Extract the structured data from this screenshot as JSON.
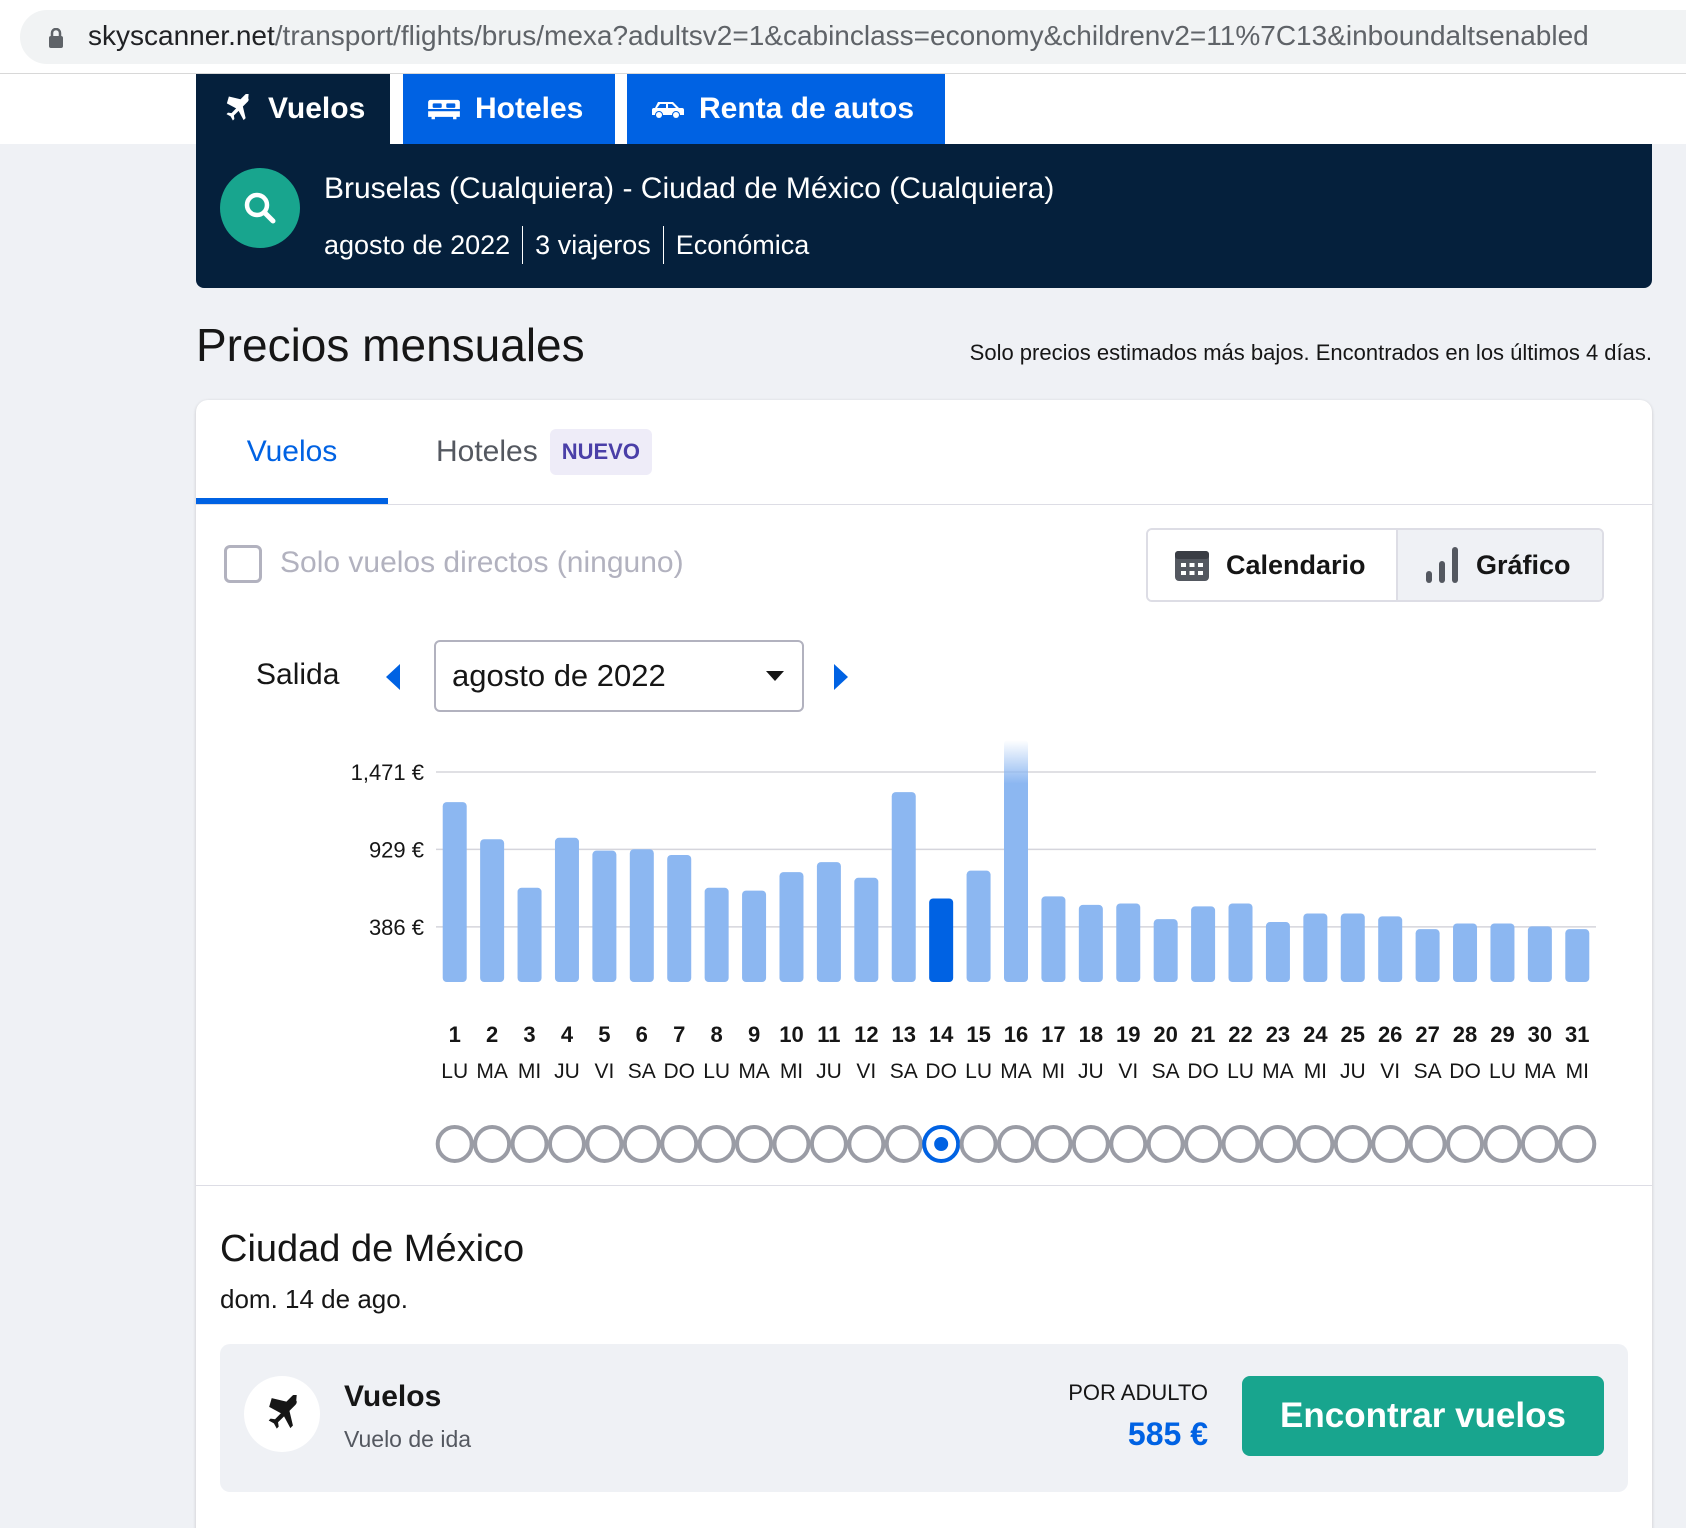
{
  "browser": {
    "url_host": "skyscanner.net",
    "url_path": "/transport/flights/brus/mexa?adultsv2=1&cabinclass=economy&childrenv2=11%7C13&inboundaltsenabled"
  },
  "product_tabs": [
    {
      "label": "Vuelos",
      "icon": "plane-icon",
      "active": true
    },
    {
      "label": "Hoteles",
      "icon": "bed-icon",
      "active": false
    },
    {
      "label": "Renta de autos",
      "icon": "car-icon",
      "active": false
    }
  ],
  "search_summary": {
    "route": "Bruselas (Cualquiera) - Ciudad de México (Cualquiera)",
    "month": "agosto de 2022",
    "travellers": "3 viajeros",
    "cabin": "Económica"
  },
  "heading": {
    "title": "Precios mensuales",
    "note": "Solo precios estimados más bajos. Encontrados en los últimos 4 días."
  },
  "card_tabs": {
    "flights": "Vuelos",
    "hotels": "Hoteles",
    "hotels_badge": "NUEVO"
  },
  "filters": {
    "direct_only_label": "Solo vuelos directos (ninguno)",
    "direct_only_checked": false
  },
  "view_toggle": {
    "calendar": "Calendario",
    "chart": "Gráfico",
    "selected": "Gráfico"
  },
  "departure": {
    "label": "Salida",
    "month_value": "agosto de 2022"
  },
  "colors": {
    "bar": "#8cb7f1",
    "bar_selected": "#0062e3",
    "accent": "#0062e3",
    "teal": "#18a58e",
    "navy": "#05203c"
  },
  "chart_data": {
    "type": "bar",
    "ylabel_ticks": [
      "1,471 €",
      "929 €",
      "386 €"
    ],
    "ytick_values": [
      1471,
      929,
      386
    ],
    "ylim": [
      0,
      1471
    ],
    "days": [
      "1",
      "2",
      "3",
      "4",
      "5",
      "6",
      "7",
      "8",
      "9",
      "10",
      "11",
      "12",
      "13",
      "14",
      "15",
      "16",
      "17",
      "18",
      "19",
      "20",
      "21",
      "22",
      "23",
      "24",
      "25",
      "26",
      "27",
      "28",
      "29",
      "30",
      "31"
    ],
    "weekdays": [
      "LU",
      "MA",
      "MI",
      "JU",
      "VI",
      "SA",
      "DO",
      "LU",
      "MA",
      "MI",
      "JU",
      "VI",
      "SA",
      "DO",
      "LU",
      "MA",
      "MI",
      "JU",
      "VI",
      "SA",
      "DO",
      "LU",
      "MA",
      "MI",
      "JU",
      "VI",
      "SA",
      "DO",
      "LU",
      "MA",
      "MI"
    ],
    "values": [
      1260,
      1000,
      660,
      1010,
      920,
      930,
      890,
      660,
      640,
      770,
      840,
      730,
      1330,
      585,
      780,
      1750,
      600,
      540,
      550,
      440,
      530,
      550,
      420,
      480,
      480,
      460,
      370,
      410,
      410,
      390,
      370
    ],
    "selected_index": 13,
    "overflow_indices": [
      15
    ],
    "grid": true
  },
  "result": {
    "destination": "Ciudad de México",
    "date": "dom. 14 de ago.",
    "row_title": "Vuelos",
    "row_subtitle": "Vuelo de ida",
    "per_adult_label": "POR ADULTO",
    "price": "585 €",
    "button": "Encontrar vuelos"
  }
}
